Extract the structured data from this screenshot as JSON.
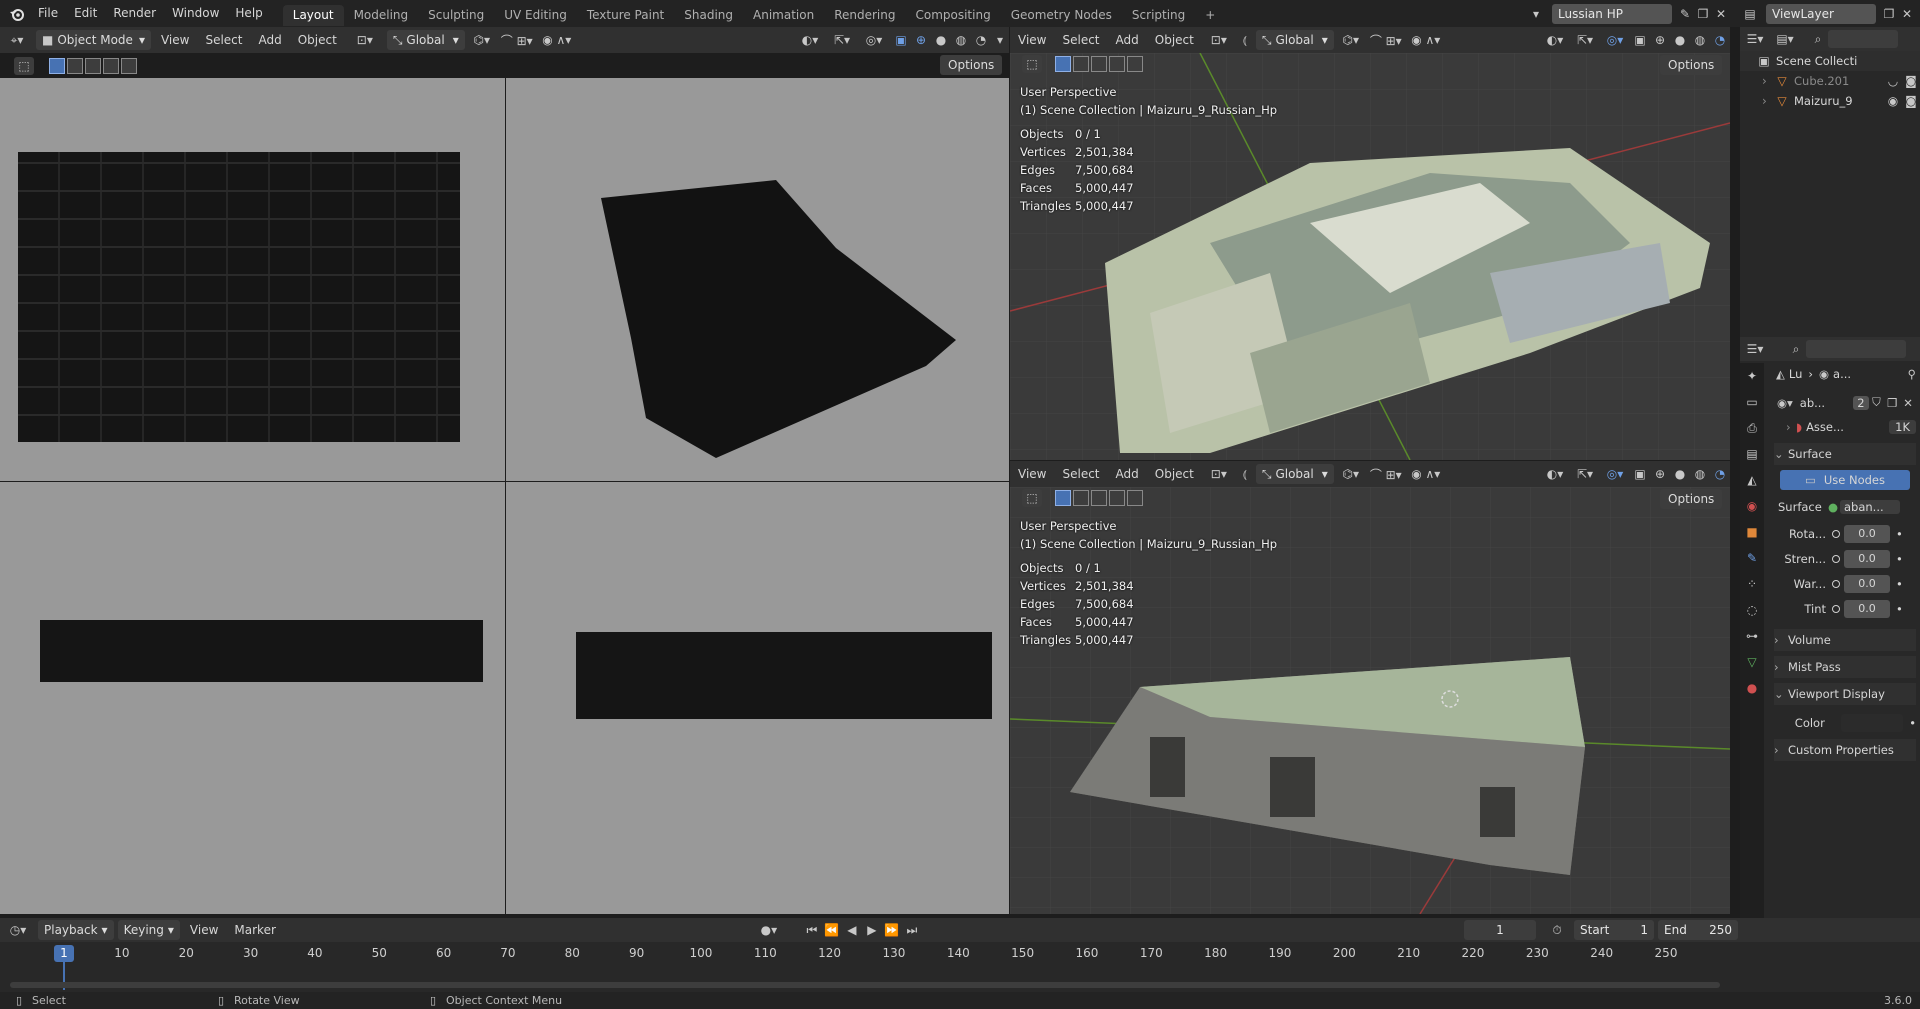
{
  "topbar": {
    "menus": [
      "File",
      "Edit",
      "Render",
      "Window",
      "Help"
    ],
    "workspaces": [
      "Layout",
      "Modeling",
      "Sculpting",
      "UV Editing",
      "Texture Paint",
      "Shading",
      "Animation",
      "Rendering",
      "Compositing",
      "Geometry Nodes",
      "Scripting"
    ],
    "add_tab": "+",
    "scene_name": "Lussian HP",
    "view_layer": "ViewLayer"
  },
  "left_header": {
    "mode": "Object Mode",
    "menus": [
      "View",
      "Select",
      "Add",
      "Object"
    ],
    "orientation": "Global",
    "options": "Options"
  },
  "vp_top": {
    "menus": [
      "View",
      "Select",
      "Add",
      "Object"
    ],
    "orientation": "Global",
    "options": "Options",
    "title": "User Perspective",
    "collection": "(1) Scene Collection | Maizuru_9_Russian_Hp"
  },
  "vp_bottom": {
    "menus": [
      "View",
      "Select",
      "Add",
      "Object"
    ],
    "orientation": "Global",
    "options": "Options",
    "title": "User Perspective",
    "collection": "(1) Scene Collection | Maizuru_9_Russian_Hp"
  },
  "stats": [
    {
      "label": "Objects",
      "value": "0 / 1"
    },
    {
      "label": "Vertices",
      "value": "2,501,384"
    },
    {
      "label": "Edges",
      "value": "7,500,684"
    },
    {
      "label": "Faces",
      "value": "5,000,447"
    },
    {
      "label": "Triangles",
      "value": "5,000,447"
    }
  ],
  "outliner": {
    "root": "Scene Collecti",
    "items": [
      "Cube.201",
      "Maizuru_9"
    ]
  },
  "props": {
    "crumb1": "Lu",
    "crumb2": "a...",
    "world_name": "ab...",
    "users": "2",
    "asset": "Asse...",
    "res": "1K",
    "surface_header": "Surface",
    "use_nodes": "Use Nodes",
    "surface_label": "Surface",
    "surface_value": "aban...",
    "rows": [
      {
        "label": "Rota...",
        "value": "0.0"
      },
      {
        "label": "Stren...",
        "value": "0.0"
      },
      {
        "label": "War...",
        "value": "0.0"
      },
      {
        "label": "Tint",
        "value": "0.0"
      }
    ],
    "volume": "Volume",
    "mist": "Mist Pass",
    "viewport_display": "Viewport Display",
    "color": "Color",
    "custom": "Custom Properties"
  },
  "timeline": {
    "menus": [
      "Playback",
      "Keying",
      "View",
      "Marker"
    ],
    "current": "1",
    "start_label": "Start",
    "start": "1",
    "end_label": "End",
    "end": "250",
    "ticks": [
      "1",
      "10",
      "20",
      "30",
      "40",
      "50",
      "60",
      "70",
      "80",
      "90",
      "100",
      "110",
      "120",
      "130",
      "140",
      "150",
      "160",
      "170",
      "180",
      "190",
      "200",
      "210",
      "220",
      "230",
      "240",
      "250"
    ]
  },
  "status": {
    "select": "Select",
    "rotate": "Rotate View",
    "context": "Object Context Menu",
    "version": "3.6.0"
  },
  "colors": {
    "accent": "#4772b3",
    "bg": "#303030"
  }
}
